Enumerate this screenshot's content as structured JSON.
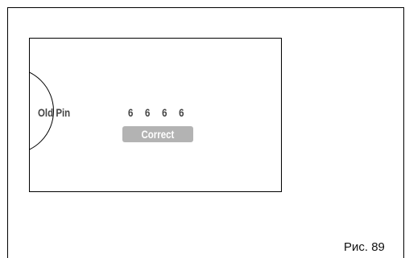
{
  "screen": {
    "old_pin_label": "Old Pin",
    "pin_digits": "6 6 6 6",
    "status_badge": "Correct"
  },
  "caption": "Рис. 89",
  "colors": {
    "badge_background": "#b3b3b3",
    "badge_text": "#ffffff",
    "label_text": "#444444"
  }
}
